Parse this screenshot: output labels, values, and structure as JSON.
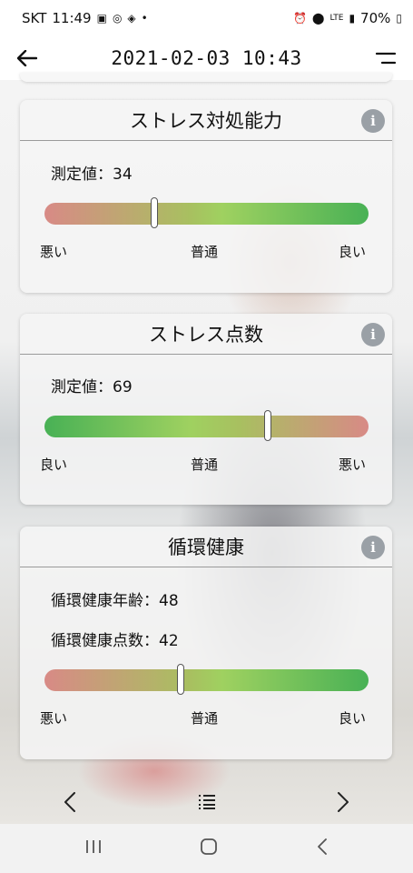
{
  "status": {
    "carrier": "SKT",
    "time": "11:49",
    "network": "LTE",
    "battery": "70%"
  },
  "header": {
    "title": "2021-02-03 10:43"
  },
  "cards": [
    {
      "title": "ストレス対処能力",
      "value_label": "測定値：",
      "value": "34",
      "scale": {
        "left": "悪い",
        "middle": "普通",
        "right": "良い"
      },
      "level_percent": 34
    },
    {
      "title": "ストレス点数",
      "value_label": "測定値：",
      "value": "69",
      "scale": {
        "left": "良い",
        "middle": "普通",
        "right": "悪い"
      },
      "level_percent": 69
    },
    {
      "title": "循環健康",
      "age_label": "循環健康年齢：",
      "age_value": "48",
      "score_label": "循環健康点数：",
      "score_value": "42",
      "scale": {
        "left": "悪い",
        "middle": "普通",
        "right": "良い"
      },
      "level_percent": 42
    }
  ],
  "colors": {
    "good": "#48b155",
    "bad": "#d88a86",
    "info": "#9aa0a6"
  },
  "icons": {
    "back": "arrow-left-icon",
    "menu": "menu-icon",
    "prev": "chevron-left-icon",
    "list": "list-icon",
    "next": "chevron-right-icon"
  }
}
